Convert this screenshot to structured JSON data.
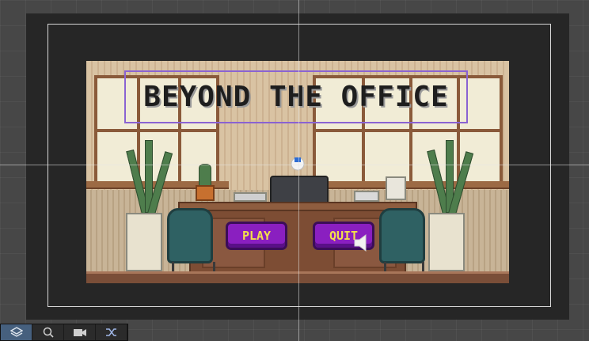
{
  "game": {
    "title": "BEYOND THE OFFICE",
    "play_label": "PLAY",
    "quit_label": "QUIT"
  },
  "toolbar": {
    "tools": [
      {
        "icon": "layers-icon",
        "active": true
      },
      {
        "icon": "search-icon",
        "active": false
      },
      {
        "icon": "camera-icon",
        "active": false
      },
      {
        "icon": "shuffle-icon",
        "active": false
      }
    ]
  },
  "colors": {
    "button_fill": "#8a1fc0",
    "button_text": "#f3e04a",
    "title_outline": "#8a63d2",
    "editor_background": "#474747",
    "camera_frame": "#262626"
  }
}
